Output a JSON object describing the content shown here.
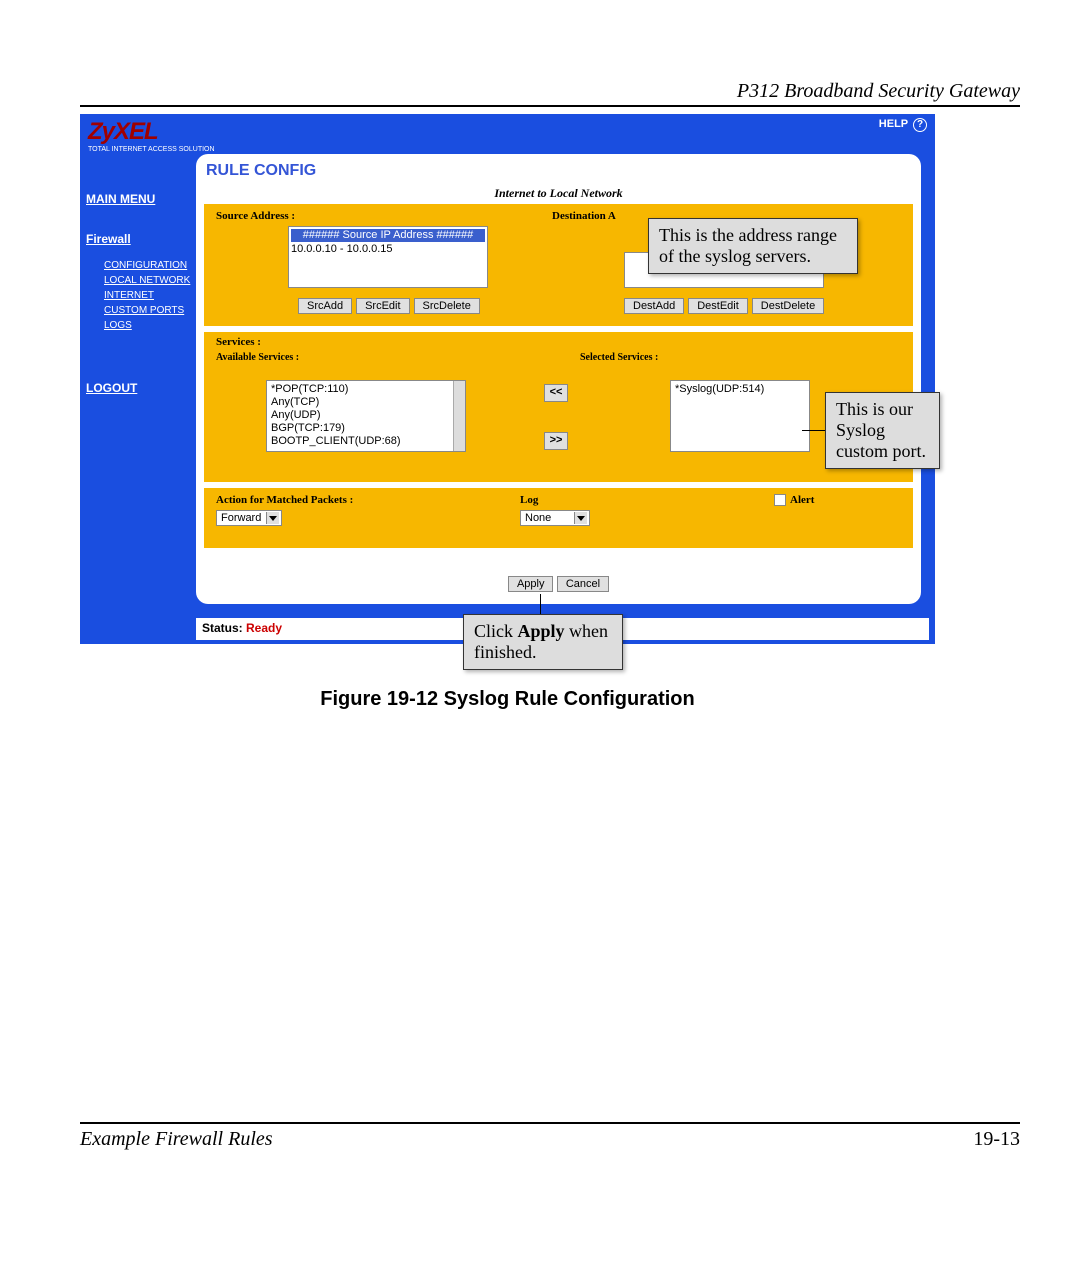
{
  "doc": {
    "header": "P312  Broadband Security Gateway",
    "footer_left": "Example Firewall Rules",
    "footer_right": "19-13",
    "fig_caption": "Figure 19-12    Syslog Rule Configuration"
  },
  "app": {
    "brand": "ZyXEL",
    "brand_sub": "TOTAL INTERNET ACCESS SOLUTION",
    "help": "HELP",
    "title": "RULE CONFIG",
    "route": "Internet to Local Network",
    "status_label": "Status:",
    "status_value": "Ready"
  },
  "nav": {
    "main": "MAIN MENU",
    "firewall": "Firewall",
    "items": [
      "CONFIGURATION",
      "LOCAL NETWORK",
      "INTERNET",
      "CUSTOM PORTS",
      "LOGS"
    ],
    "logout": "LOGOUT"
  },
  "addr": {
    "src_label": "Source Address :",
    "dest_label": "Destination A",
    "src_header": "###### Source IP Address ######",
    "src_range": "10.0.0.10 - 10.0.0.15",
    "btn_src": [
      "SrcAdd",
      "SrcEdit",
      "SrcDelete"
    ],
    "btn_dst": [
      "DestAdd",
      "DestEdit",
      "DestDelete"
    ]
  },
  "svc": {
    "label": "Services :",
    "avail_label": "Available Services :",
    "sel_label": "Selected Services :",
    "avail": [
      "*POP(TCP:110)",
      "Any(TCP)",
      "Any(UDP)",
      "BGP(TCP:179)",
      "BOOTP_CLIENT(UDP:68)"
    ],
    "selected": [
      "*Syslog(UDP:514)"
    ],
    "move_left": "<<",
    "move_right": ">>"
  },
  "action": {
    "label": "Action for Matched Packets :",
    "value": "Forward",
    "log_label": "Log",
    "log_value": "None",
    "alert_label": "Alert",
    "apply": "Apply",
    "cancel": "Cancel"
  },
  "callouts": {
    "c1": "This is the address range of the syslog servers.",
    "c2": "This is our Syslog custom port.",
    "c3a": "Click ",
    "c3b": "Apply",
    "c3c": " when finished."
  }
}
